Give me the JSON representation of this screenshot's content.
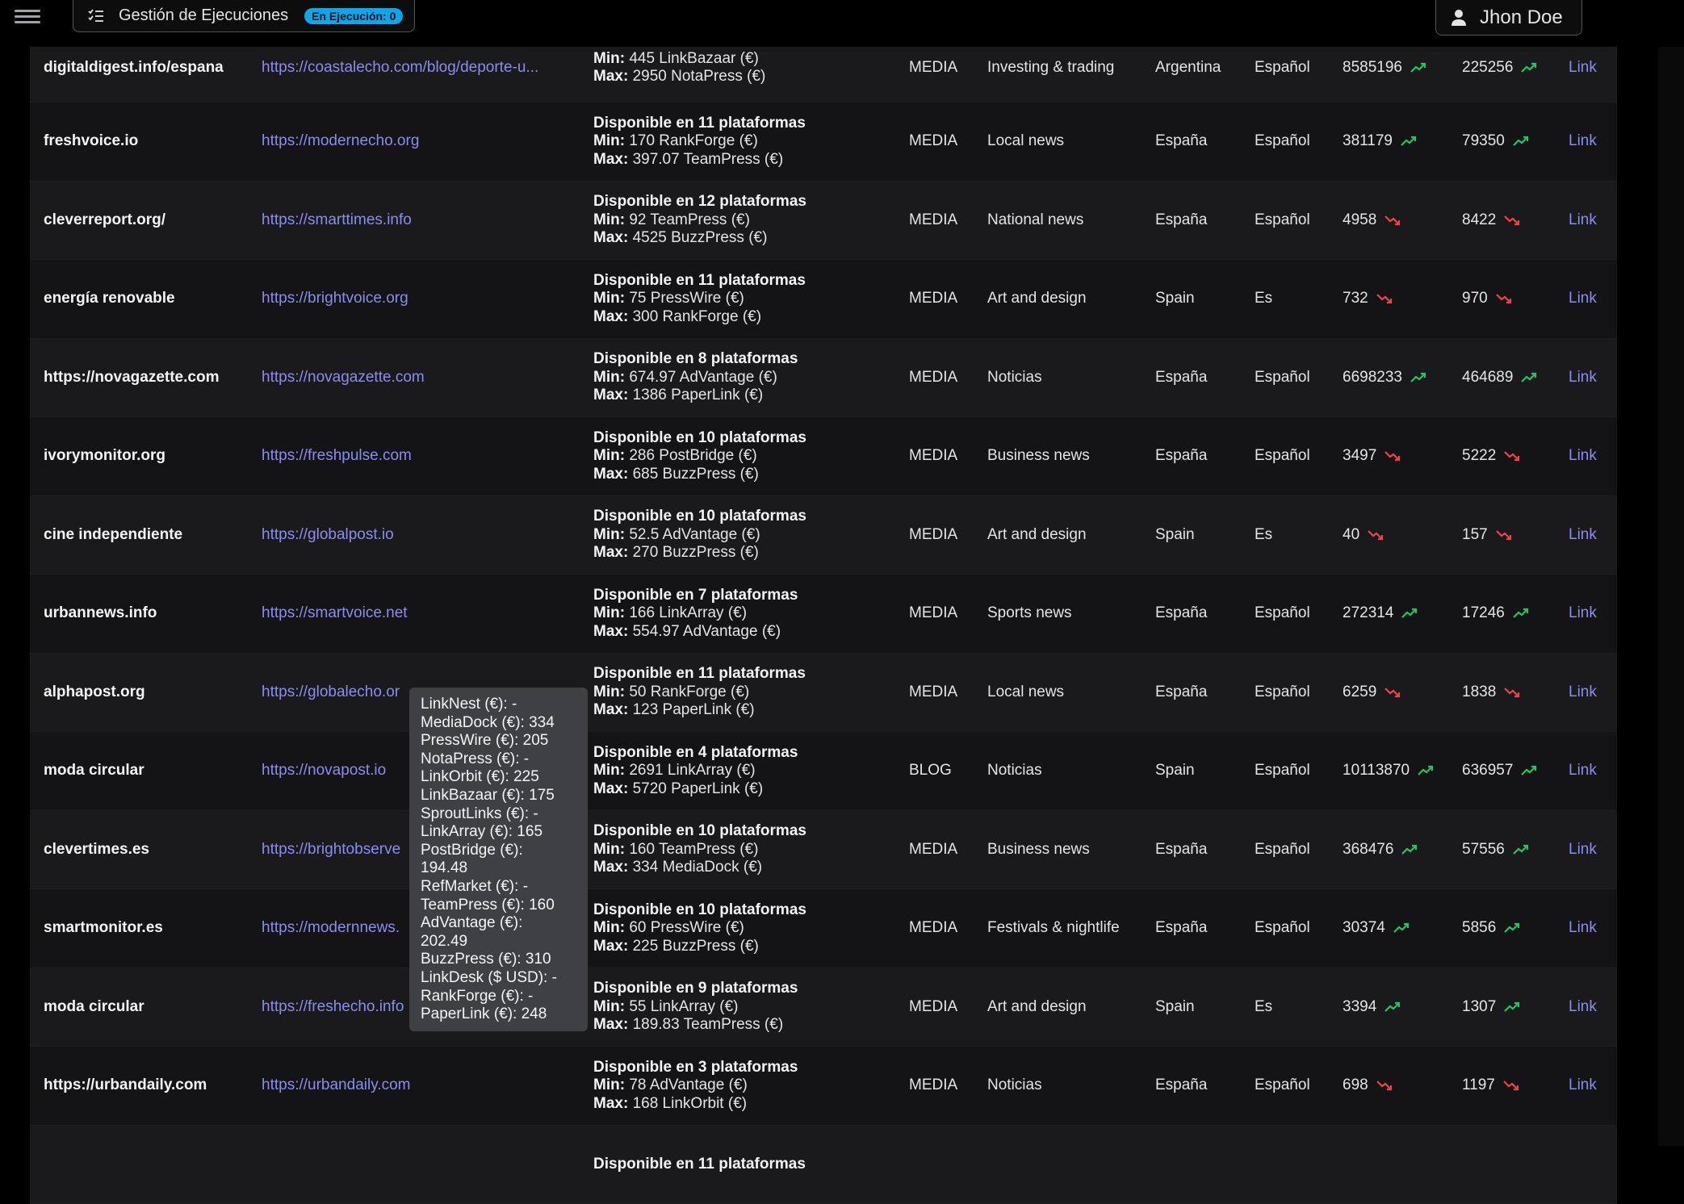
{
  "header": {
    "exec_title": "Gestión de Ejecuciones",
    "exec_badge": "En Ejecución: 0",
    "user_name": "Jhon Doe"
  },
  "colors": {
    "up": "#22c55e",
    "down": "#ef4444",
    "link": "#8b8cf0",
    "badge": "#0ea5e9"
  },
  "rows": [
    {
      "name": "digitaldigest.info/espana",
      "url": "https://coastalecho.com/blog/deporte-u...",
      "plat": "",
      "min": "445 LinkBazaar (€)",
      "max": "2950 NotaPress (€)",
      "type": "MEDIA",
      "cat": "Investing & trading",
      "country": "Argentina",
      "lang": "Español",
      "m1": "8585196",
      "t1": "up",
      "m2": "225256",
      "t2": "up",
      "link": "Link"
    },
    {
      "name": "freshvoice.io",
      "url": "https://modernecho.org",
      "plat": "Disponible en 11 plataformas",
      "min": "170 RankForge (€)",
      "max": "397.07 TeamPress (€)",
      "type": "MEDIA",
      "cat": "Local news",
      "country": "España",
      "lang": "Español",
      "m1": "381179",
      "t1": "up",
      "m2": "79350",
      "t2": "up",
      "link": "Link"
    },
    {
      "name": "cleverreport.org/",
      "url": "https://smarttimes.info",
      "plat": "Disponible en 12 plataformas",
      "min": "92 TeamPress (€)",
      "max": "4525 BuzzPress (€)",
      "type": "MEDIA",
      "cat": "National news",
      "country": "España",
      "lang": "Español",
      "m1": "4958",
      "t1": "down",
      "m2": "8422",
      "t2": "down",
      "link": "Link"
    },
    {
      "name": "energía renovable",
      "url": "https://brightvoice.org",
      "plat": "Disponible en 11 plataformas",
      "min": "75 PressWire (€)",
      "max": "300 RankForge (€)",
      "type": "MEDIA",
      "cat": "Art and design",
      "country": "Spain",
      "lang": "Es",
      "m1": "732",
      "t1": "down",
      "m2": "970",
      "t2": "down",
      "link": "Link"
    },
    {
      "name": "https://novagazette.com",
      "url": "https://novagazette.com",
      "plat": "Disponible en 8 plataformas",
      "min": "674.97 AdVantage (€)",
      "max": "1386 PaperLink (€)",
      "type": "MEDIA",
      "cat": "Noticias",
      "country": "España",
      "lang": "Español",
      "m1": "6698233",
      "t1": "up",
      "m2": "464689",
      "t2": "up",
      "link": "Link"
    },
    {
      "name": "ivorymonitor.org",
      "url": "https://freshpulse.com",
      "plat": "Disponible en 10 plataformas",
      "min": "286 PostBridge (€)",
      "max": "685 BuzzPress (€)",
      "type": "MEDIA",
      "cat": "Business news",
      "country": "España",
      "lang": "Español",
      "m1": "3497",
      "t1": "down",
      "m2": "5222",
      "t2": "down",
      "link": "Link"
    },
    {
      "name": "cine independiente",
      "url": "https://globalpost.io",
      "plat": "Disponible en 10 plataformas",
      "min": "52.5 AdVantage (€)",
      "max": "270 BuzzPress (€)",
      "type": "MEDIA",
      "cat": "Art and design",
      "country": "Spain",
      "lang": "Es",
      "m1": "40",
      "t1": "down",
      "m2": "157",
      "t2": "down",
      "link": "Link"
    },
    {
      "name": "urbannews.info",
      "url": "https://smartvoice.net",
      "plat": "Disponible en 7 plataformas",
      "min": "166 LinkArray (€)",
      "max": "554.97 AdVantage (€)",
      "type": "MEDIA",
      "cat": "Sports news",
      "country": "España",
      "lang": "Español",
      "m1": "272314",
      "t1": "up",
      "m2": "17246",
      "t2": "up",
      "link": "Link"
    },
    {
      "name": "alphapost.org",
      "url": "https://globalecho.or",
      "plat": "Disponible en 11 plataformas",
      "min": "50 RankForge (€)",
      "max": "123 PaperLink (€)",
      "type": "MEDIA",
      "cat": "Local news",
      "country": "España",
      "lang": "Español",
      "m1": "6259",
      "t1": "down",
      "m2": "1838",
      "t2": "down",
      "link": "Link"
    },
    {
      "name": "moda circular",
      "url": "https://novapost.io",
      "plat": "Disponible en 4 plataformas",
      "min": "2691 LinkArray (€)",
      "max": "5720 PaperLink (€)",
      "type": "BLOG",
      "cat": "Noticias",
      "country": "Spain",
      "lang": "Español",
      "m1": "10113870",
      "t1": "up",
      "m2": "636957",
      "t2": "up",
      "link": "Link"
    },
    {
      "name": "clevertimes.es",
      "url": "https://brightobserve",
      "plat": "Disponible en 10 plataformas",
      "min": "160 TeamPress (€)",
      "max": "334 MediaDock (€)",
      "type": "MEDIA",
      "cat": "Business news",
      "country": "España",
      "lang": "Español",
      "m1": "368476",
      "t1": "up",
      "m2": "57556",
      "t2": "up",
      "link": "Link"
    },
    {
      "name": "smartmonitor.es",
      "url": "https://modernnews.",
      "plat": "Disponible en 10 plataformas",
      "min": "60 PressWire (€)",
      "max": "225 BuzzPress (€)",
      "type": "MEDIA",
      "cat": "Festivals & nightlife",
      "country": "España",
      "lang": "Español",
      "m1": "30374",
      "t1": "up",
      "m2": "5856",
      "t2": "up",
      "link": "Link"
    },
    {
      "name": "moda circular",
      "url": "https://freshecho.info",
      "plat": "Disponible en 9 plataformas",
      "min": "55 LinkArray (€)",
      "max": "189.83 TeamPress (€)",
      "type": "MEDIA",
      "cat": "Art and design",
      "country": "Spain",
      "lang": "Es",
      "m1": "3394",
      "t1": "up",
      "m2": "1307",
      "t2": "up",
      "link": "Link"
    },
    {
      "name": "https://urbandaily.com",
      "url": "https://urbandaily.com",
      "plat": "Disponible en 3 plataformas",
      "min": "78 AdVantage (€)",
      "max": "168 LinkOrbit (€)",
      "type": "MEDIA",
      "cat": "Noticias",
      "country": "España",
      "lang": "Español",
      "m1": "698",
      "t1": "down",
      "m2": "1197",
      "t2": "down",
      "link": "Link"
    },
    {
      "name": "",
      "url": "",
      "plat": "Disponible en 11 plataformas",
      "min": "",
      "max": "",
      "type": "",
      "cat": "",
      "country": "",
      "lang": "",
      "m1": "",
      "t1": "",
      "m2": "",
      "t2": "",
      "link": ""
    }
  ],
  "labels": {
    "min": "Min:",
    "max": "Max:"
  },
  "tooltip": [
    "LinkNest (€): -",
    "MediaDock (€): 334",
    "PressWire (€): 205",
    "NotaPress (€): -",
    "LinkOrbit (€): 225",
    "LinkBazaar (€): 175",
    "SproutLinks (€): -",
    "LinkArray (€): 165",
    "PostBridge (€):",
    "194.48",
    "RefMarket (€): -",
    "TeamPress (€): 160",
    "AdVantage (€):",
    "202.49",
    "BuzzPress (€): 310",
    "LinkDesk ($ USD): -",
    "RankForge (€): -",
    "PaperLink (€): 248"
  ]
}
